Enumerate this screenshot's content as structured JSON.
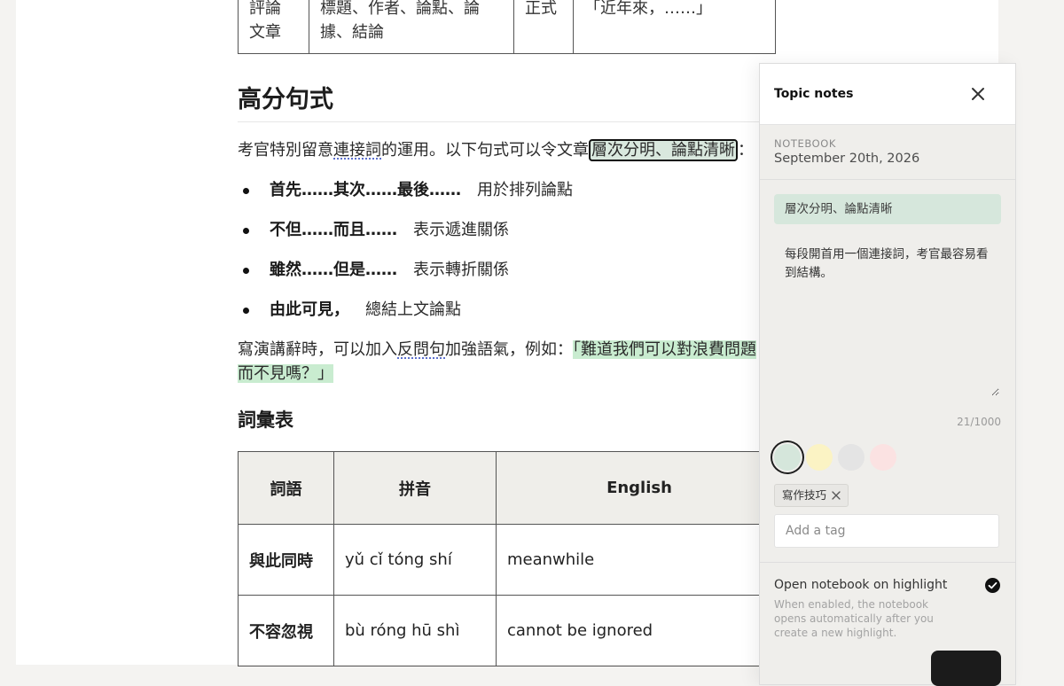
{
  "top_table": {
    "cells": [
      "評論\n文章",
      "標題、作者、論點、論\n據、結論",
      "正式",
      "「近年來，……」"
    ]
  },
  "section_title": "高分句式",
  "intro": {
    "t1": "考官特別留意",
    "t2": "連接詞",
    "t3": "的運用。以下句式可以令文章",
    "highlight": "層次分明、論點清晰",
    "t4": "："
  },
  "bullets": [
    {
      "pattern": "首先……其次……最後……",
      "desc": "用於排列論點"
    },
    {
      "pattern": "不但……而且……",
      "desc": "表示遞進關係"
    },
    {
      "pattern": "雖然……但是……",
      "desc": "表示轉折關係"
    },
    {
      "pattern": "由此可見，",
      "desc": "總結上文論點"
    }
  ],
  "rhetoric": {
    "t1": "寫演講辭時，可以加入",
    "t2": "反問句",
    "t3": "加強語氣，例如：",
    "example_line1": "「難道我們可以對浪費問題",
    "example_line2": "而不見嗎？」"
  },
  "vocab_title": "詞彙表",
  "vocab_table": {
    "headers": [
      "詞語",
      "拼音",
      "English"
    ],
    "rows": [
      {
        "term": "與此同時",
        "pinyin": "yǔ cǐ tóng shí",
        "english": "meanwhile"
      },
      {
        "term": "不容忽視",
        "pinyin": "bù róng hū shì",
        "english": "cannot be ignored"
      }
    ]
  },
  "panel": {
    "title": "Topic notes",
    "notebook_label": "NOTEBOOK",
    "notebook_date": "September 20th, 2026",
    "quote": "層次分明、論點清晰",
    "note_text": "每段開首用一個連接詞，考官最容易看到結構。",
    "counter": "21/1000",
    "swatches": [
      "#d5e6db",
      "#fbf3c4",
      "#e4e4e4",
      "#fbe2e2"
    ],
    "tag": "寫作技巧",
    "tag_placeholder": "Add a tag",
    "setting_title": "Open notebook on highlight",
    "setting_desc": "When enabled, the notebook opens automatically after you create a new highlight."
  }
}
